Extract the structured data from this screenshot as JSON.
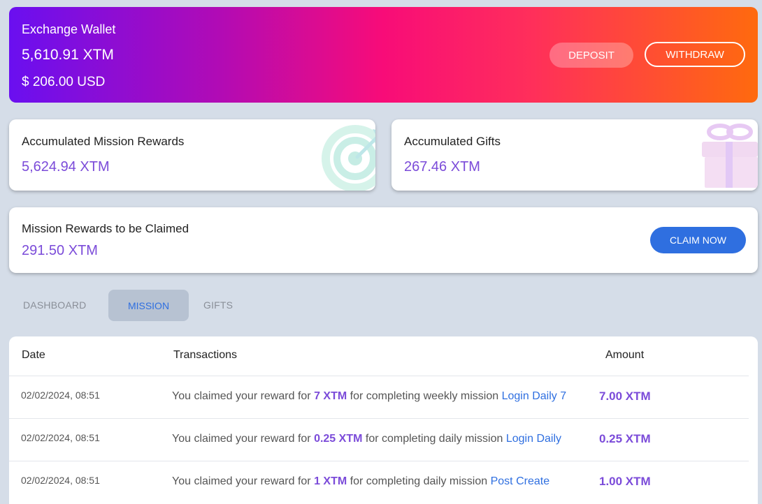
{
  "wallet": {
    "title": "Exchange Wallet",
    "balance_xtm": "5,610.91 XTM",
    "balance_usd": "$ 206.00 USD",
    "deposit_label": "DEPOSIT",
    "withdraw_label": "WITHDRAW"
  },
  "mission_rewards": {
    "label": "Accumulated Mission Rewards",
    "value": "5,624.94 XTM",
    "icon": "target-icon"
  },
  "gifts": {
    "label": "Accumulated Gifts",
    "value": "267.46 XTM",
    "icon": "gift-icon"
  },
  "to_claim": {
    "label": "Mission Rewards to be Claimed",
    "value": "291.50 XTM",
    "claim_label": "CLAIM NOW"
  },
  "tabs": [
    {
      "label": "DASHBOARD",
      "active": false
    },
    {
      "label": "MISSION",
      "active": true
    },
    {
      "label": "GIFTS",
      "active": false
    }
  ],
  "table": {
    "headers": [
      "Date",
      "Transactions",
      "Amount"
    ],
    "rows": [
      {
        "date": "02/02/2024, 08:51",
        "pre": "You claimed your reward for ",
        "reward": "7 XTM",
        "mid": " for completing weekly mission ",
        "mission": "Login Daily 7",
        "amount": "7.00 XTM"
      },
      {
        "date": "02/02/2024, 08:51",
        "pre": "You claimed your reward for ",
        "reward": "0.25 XTM",
        "mid": " for completing daily mission ",
        "mission": "Login Daily",
        "amount": "0.25 XTM"
      },
      {
        "date": "02/02/2024, 08:51",
        "pre": "You claimed your reward for ",
        "reward": "1 XTM",
        "mid": " for completing daily mission ",
        "mission": "Post Create",
        "amount": "1.00 XTM"
      }
    ]
  },
  "colors": {
    "accent_purple": "#7b4bd9",
    "link_blue": "#2f6fe0",
    "claim_button": "#2f6fe0"
  }
}
